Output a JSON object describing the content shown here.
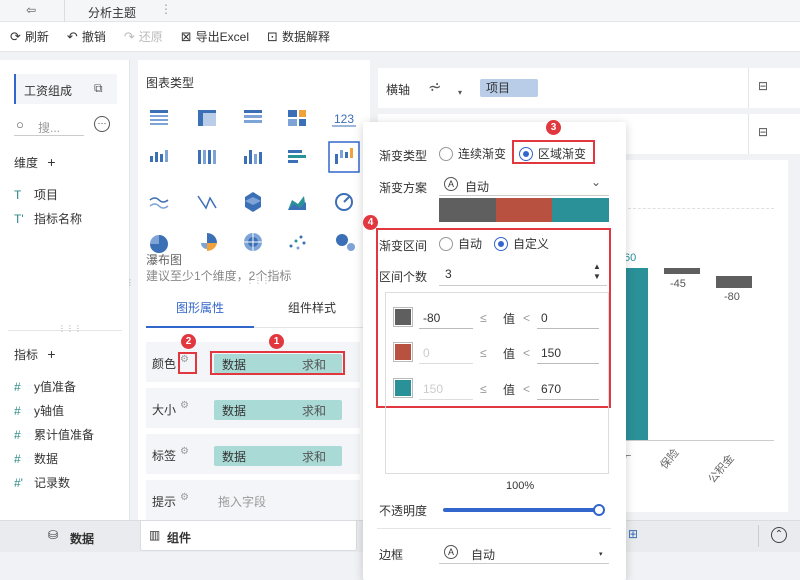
{
  "header": {
    "tab_title": "分析主题"
  },
  "toolbar": {
    "refresh": "刷新",
    "undo": "撤销",
    "redo": "还原",
    "export": "导出Excel",
    "explain": "数据解释"
  },
  "left": {
    "dataset": "工资组成",
    "search_placeholder": "搜...",
    "dimension_title": "维度",
    "dimensions": [
      "项目",
      "指标名称"
    ],
    "measure_title": "指标",
    "measures": [
      "y值准备",
      "y轴值",
      "累计值准备",
      "数据",
      "记录数"
    ]
  },
  "mid": {
    "chart_type_title": "图表类型",
    "waterfall_name": "瀑布图",
    "waterfall_hint": "建议至少1个维度，2个指标",
    "tab_shape": "图形属性",
    "tab_component": "组件样式",
    "props": [
      {
        "label": "颜色",
        "field": "数据",
        "agg": "求和"
      },
      {
        "label": "大小",
        "field": "数据",
        "agg": "求和"
      },
      {
        "label": "标签",
        "field": "数据",
        "agg": "求和"
      },
      {
        "label": "提示",
        "placeholder": "拖入字段"
      }
    ]
  },
  "axis": {
    "label": "横轴",
    "field": "项目"
  },
  "chart": {
    "labels": [
      "60",
      "-45",
      "-80"
    ],
    "xcats": [
      "保险",
      "公积金"
    ],
    "colors": {
      "teal": "#2a9199",
      "gray": "#5f5f5f",
      "red": "#b85140"
    }
  },
  "popup": {
    "gradient_type_label": "渐变类型",
    "continuous": "连续渐变",
    "regional": "区域渐变",
    "scheme_label": "渐变方案",
    "scheme_value": "自动",
    "interval_label": "渐变区间",
    "interval_auto": "自动",
    "interval_custom": "自定义",
    "count_label": "区间个数",
    "count_value": "3",
    "rows": [
      {
        "color": "#5f5f5f",
        "from": "-80",
        "cmp1": "≤",
        "mid": "值",
        "cmp2": "<",
        "to": "0"
      },
      {
        "color": "#b85140",
        "from": "0",
        "cmp1": "≤",
        "mid": "值",
        "cmp2": "<",
        "to": "150"
      },
      {
        "color": "#2a9199",
        "from": "150",
        "cmp1": "≤",
        "mid": "值",
        "cmp2": "<",
        "to": "670"
      }
    ],
    "percent": "100%",
    "opacity_label": "不透明度",
    "opacity_value": 1.0,
    "border_label": "边框",
    "border_value": "自动"
  },
  "badges": [
    "1",
    "2",
    "3",
    "4"
  ],
  "bottom": {
    "data_tab": "数据",
    "component_tab": "组件"
  }
}
